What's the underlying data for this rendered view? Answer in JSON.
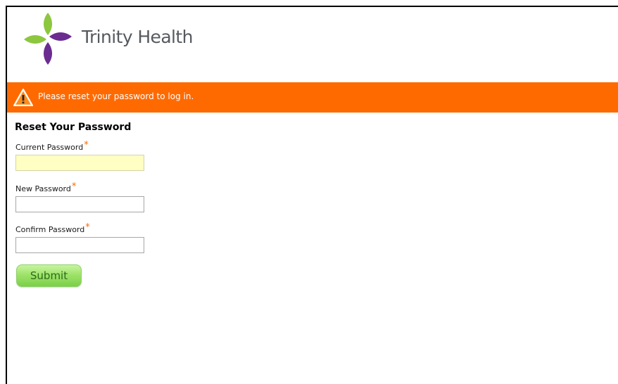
{
  "brand": {
    "name": "Trinity Health",
    "colors": {
      "purple": "#6b2c91",
      "green": "#8dc63f",
      "text_gray": "#555a5f"
    }
  },
  "alert": {
    "icon": "warning-icon",
    "message": "Please reset your password to log in.",
    "background": "#ff6a00"
  },
  "form": {
    "title": "Reset Your Password",
    "required_marker": "*",
    "fields": [
      {
        "label": "Current Password",
        "value": "",
        "focused": true
      },
      {
        "label": "New Password",
        "value": "",
        "focused": false
      },
      {
        "label": "Confirm Password",
        "value": "",
        "focused": false
      }
    ],
    "submit_label": "Submit"
  }
}
